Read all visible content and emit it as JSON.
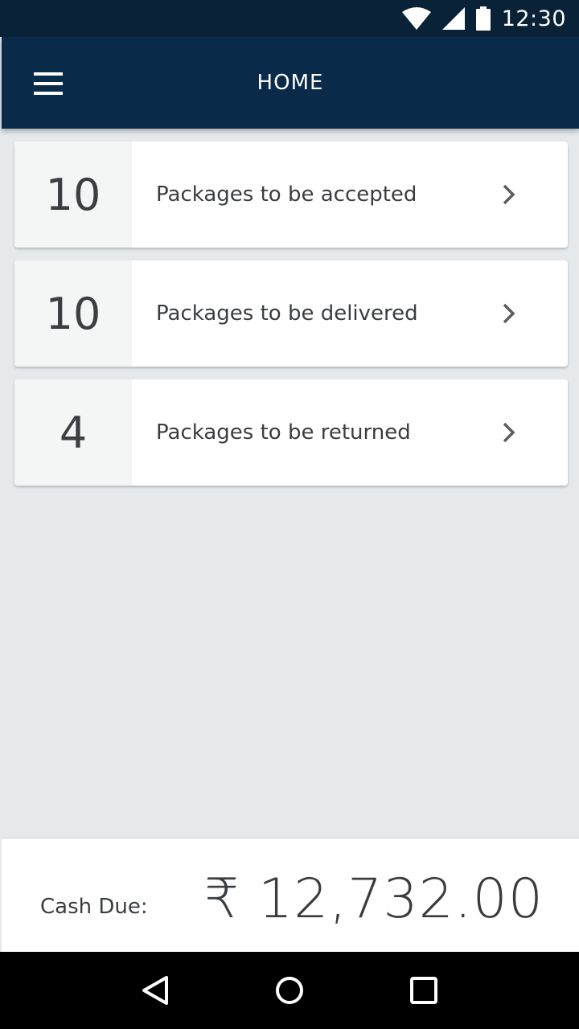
{
  "status_bar": {
    "time": "12:30",
    "icons": [
      "wifi-icon",
      "signal-icon",
      "battery-icon"
    ]
  },
  "app_bar": {
    "title": "HOME",
    "menu_icon": "menu-icon"
  },
  "packages": [
    {
      "count": "10",
      "label": "Packages to be accepted"
    },
    {
      "count": "10",
      "label": "Packages to be delivered"
    },
    {
      "count": "4",
      "label": "Packages to be returned"
    }
  ],
  "cash": {
    "label": "Cash Due:",
    "amount": "₹ 12,732.00"
  },
  "nav": {
    "icons": [
      "back-icon",
      "home-icon",
      "recents-icon"
    ]
  },
  "colors": {
    "status_bar": "#0a2238",
    "app_bar": "#092a48",
    "background": "#e6e9ec",
    "card": "#ffffff",
    "count_panel": "#f4f6f6"
  }
}
